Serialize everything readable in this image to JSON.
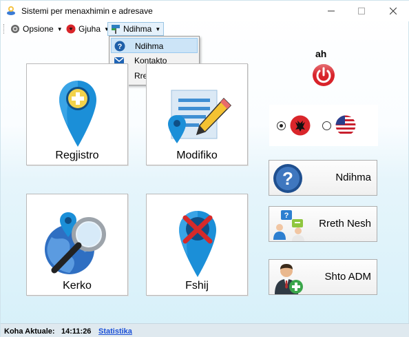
{
  "window": {
    "title": "Sistemi per menaxhimin e adresave",
    "icons": {
      "app": "address-app-icon",
      "minimize": "minimize-icon",
      "maximize": "maximize-icon",
      "close": "close-icon"
    }
  },
  "menubar": {
    "items": [
      {
        "label": "Opsione",
        "icon": "gear-icon"
      },
      {
        "label": "Gjuha",
        "icon": "language-flag-icon"
      },
      {
        "label": "Ndihma",
        "icon": "signpost-icon",
        "open": true
      }
    ]
  },
  "dropdown": {
    "items": [
      {
        "label": "Ndihma",
        "icon": "help-icon",
        "highlighted": true
      },
      {
        "label": "Kontakto",
        "icon": "mail-icon"
      },
      {
        "label": "Rreth nesh",
        "icon": "users-icon"
      }
    ]
  },
  "tiles": {
    "regjistro": {
      "label": "Regjistro",
      "icon": "map-pin-add-icon"
    },
    "modifiko": {
      "label": "Modifiko",
      "icon": "map-pin-edit-icon"
    },
    "kerko": {
      "label": "Kerko",
      "icon": "globe-search-icon"
    },
    "fshij": {
      "label": "Fshij",
      "icon": "map-pin-delete-icon"
    }
  },
  "user": {
    "name": "ah",
    "logout_icon": "power-icon"
  },
  "language": {
    "options": [
      {
        "flag": "albania-flag-icon",
        "selected": true
      },
      {
        "flag": "usa-flag-icon",
        "selected": false
      }
    ]
  },
  "side_buttons": {
    "ndihma": {
      "label": "Ndihma",
      "icon": "help-circle-icon"
    },
    "rreth": {
      "label": "Rreth Nesh",
      "icon": "chat-people-icon"
    },
    "shto": {
      "label": "Shto ADM",
      "icon": "add-admin-icon"
    }
  },
  "statusbar": {
    "label": "Koha Aktuale:",
    "time": "14:11:26",
    "link": "Statistika"
  },
  "colors": {
    "accent_blue": "#1a78c2",
    "pin_blue": "#1b8fd8",
    "power_red": "#d8232a",
    "link": "#1a4fd6"
  }
}
